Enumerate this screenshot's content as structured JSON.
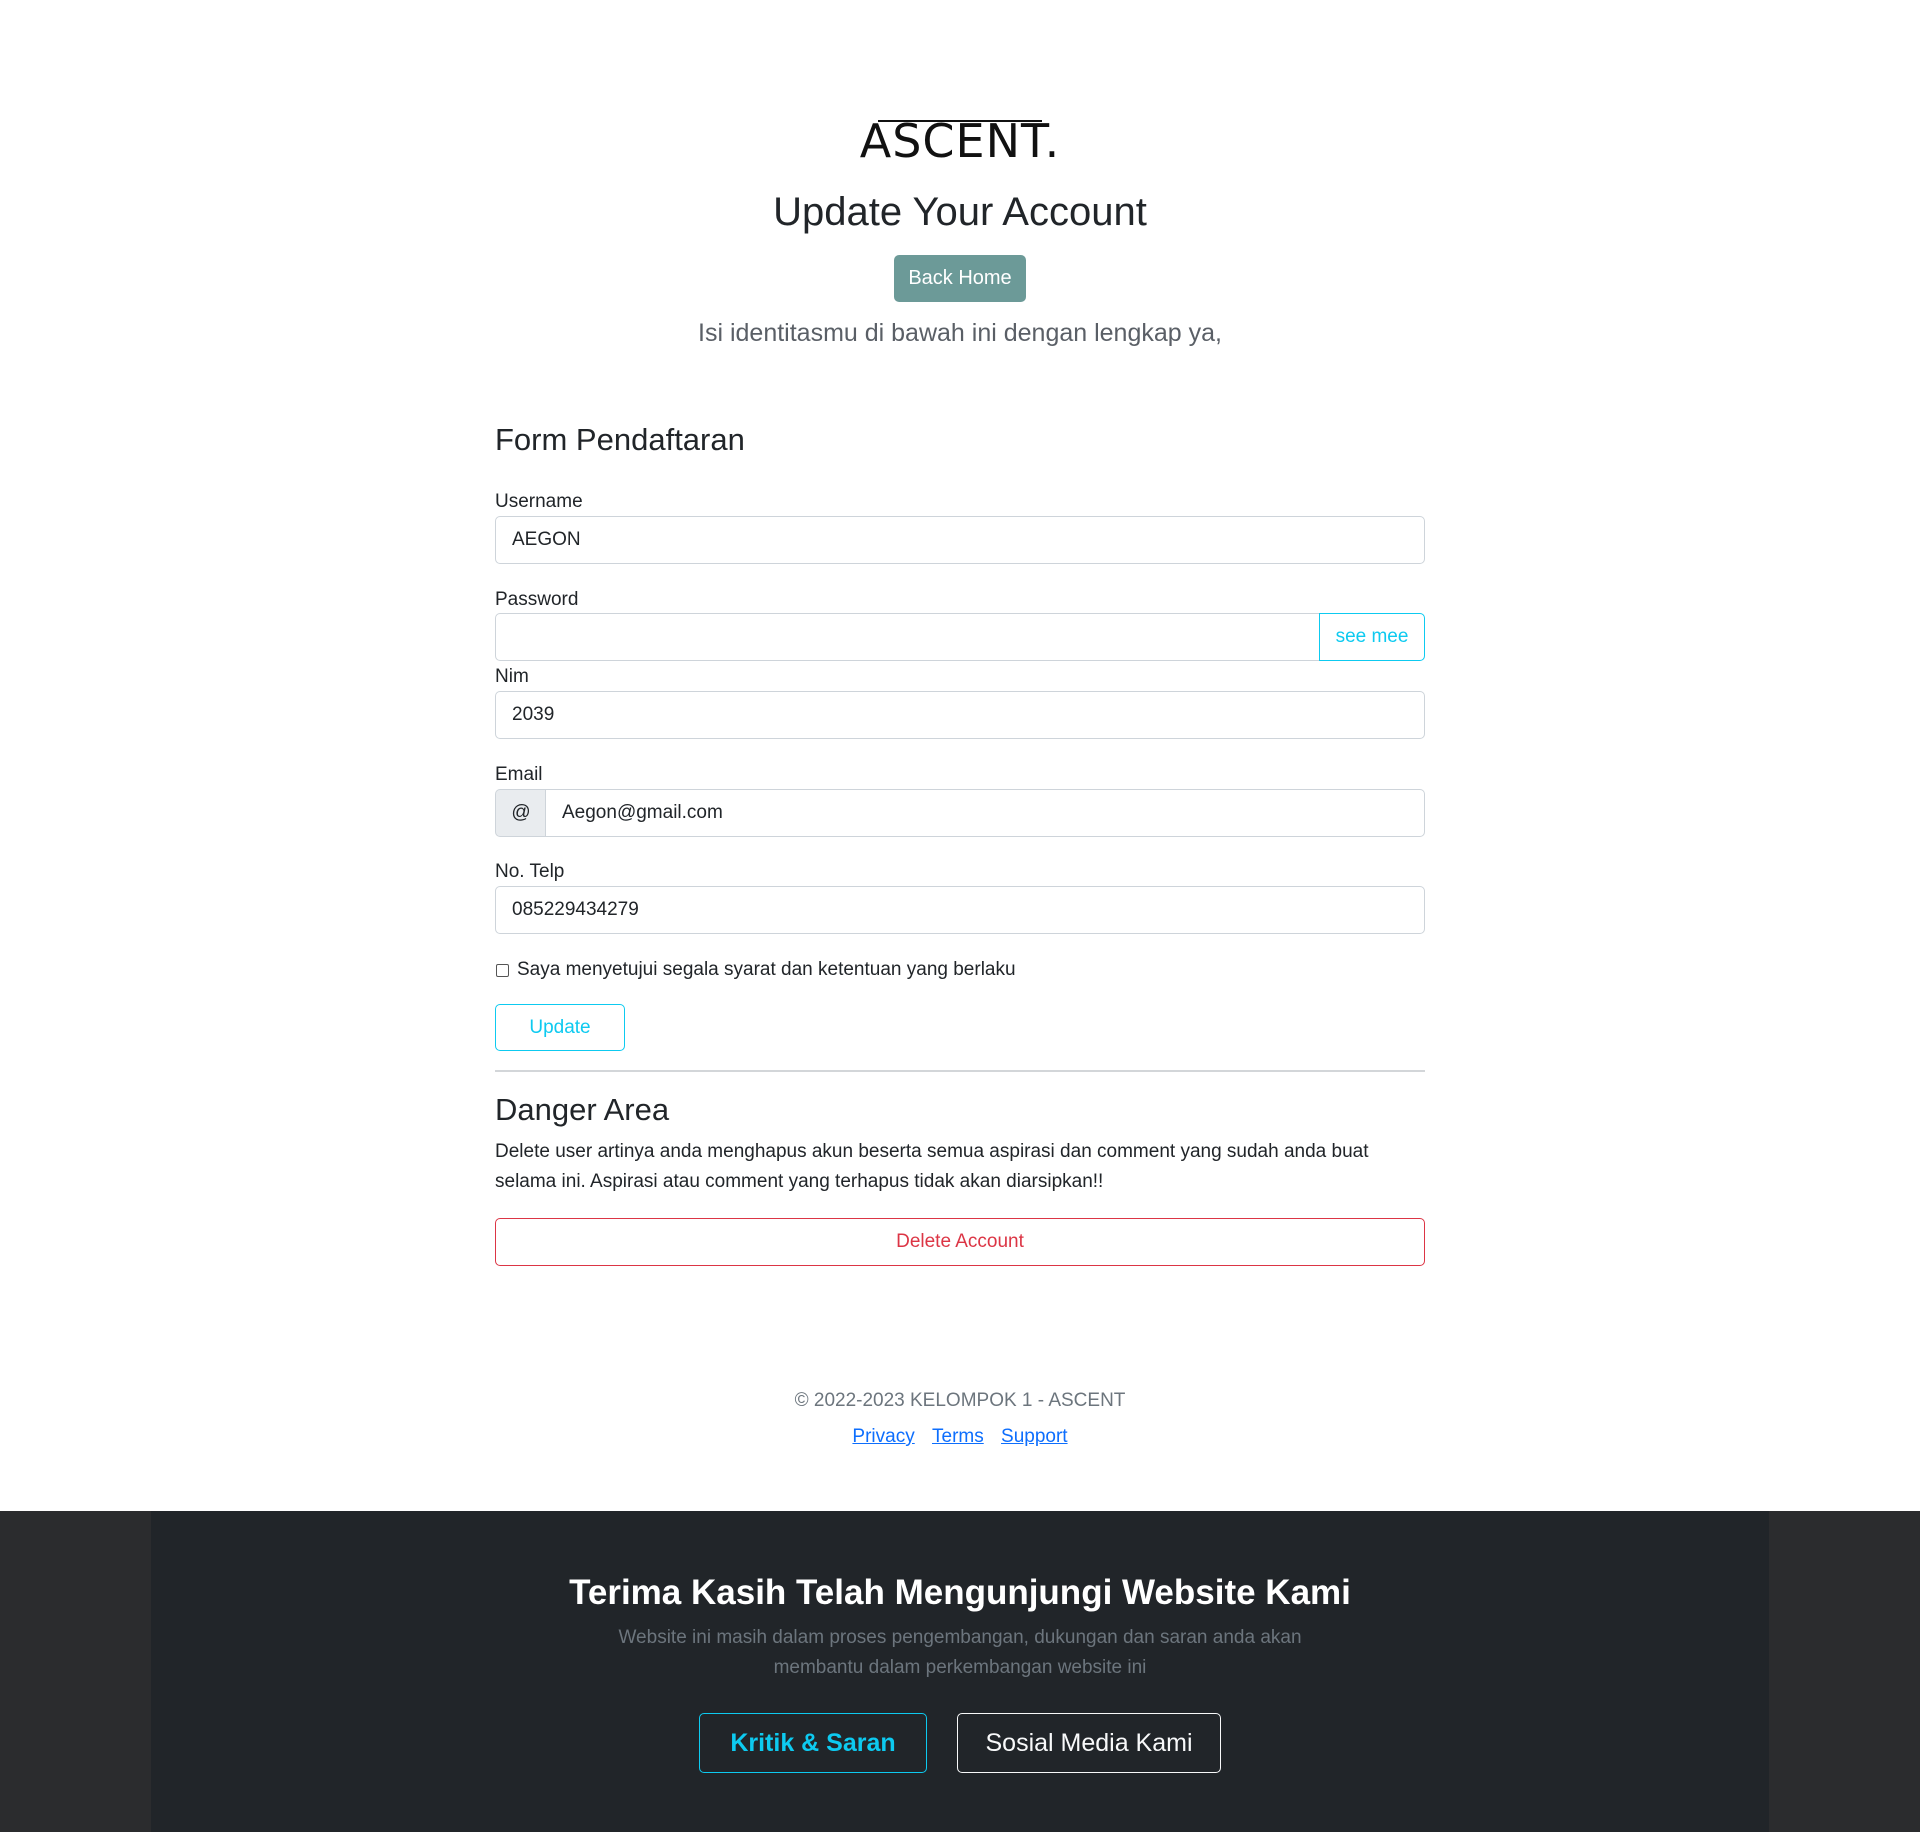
{
  "header": {
    "logo_text": "ASCENT.",
    "title": "Update Your Account",
    "back_home_label": "Back Home",
    "lead": "Isi identitasmu di bawah ini dengan lengkap ya,"
  },
  "form": {
    "title": "Form Pendaftaran",
    "username": {
      "label": "Username",
      "value": "AEGON"
    },
    "password": {
      "label": "Password",
      "value": "",
      "toggle_label": "see mee"
    },
    "nim": {
      "label": "Nim",
      "value": "2039"
    },
    "email": {
      "label": "Email",
      "addon": "@",
      "value": "Aegon@gmail.com"
    },
    "phone": {
      "label": "No. Telp",
      "value": "085229434279"
    },
    "agree": {
      "label": "Saya menyetujui segala syarat dan ketentuan yang berlaku",
      "checked": false
    },
    "submit_label": "Update"
  },
  "danger": {
    "title": "Danger Area",
    "text": "Delete user artinya anda menghapus akun beserta semua aspirasi dan comment yang sudah anda buat selama ini. Aspirasi atau comment yang terhapus tidak akan diarsipkan!!",
    "delete_label": "Delete Account"
  },
  "footer": {
    "copyright": "© 2022-2023 KELOMPOK 1 - ASCENT",
    "links": [
      "Privacy",
      "Terms",
      "Support"
    ]
  },
  "banner": {
    "title": "Terima Kasih Telah Mengunjungi Website Kami",
    "text": "Website ini masih dalam proses pengembangan, dukungan dan saran anda akan membantu dalam perkembangan website ini",
    "primary_label": "Kritik & Saran",
    "secondary_label": "Sosial Media Kami"
  },
  "colors": {
    "back_home_bg": "#6c9a98",
    "info": "#0dcaf0",
    "danger": "#dc3545",
    "link": "#0d6efd",
    "dark": "#212529"
  }
}
